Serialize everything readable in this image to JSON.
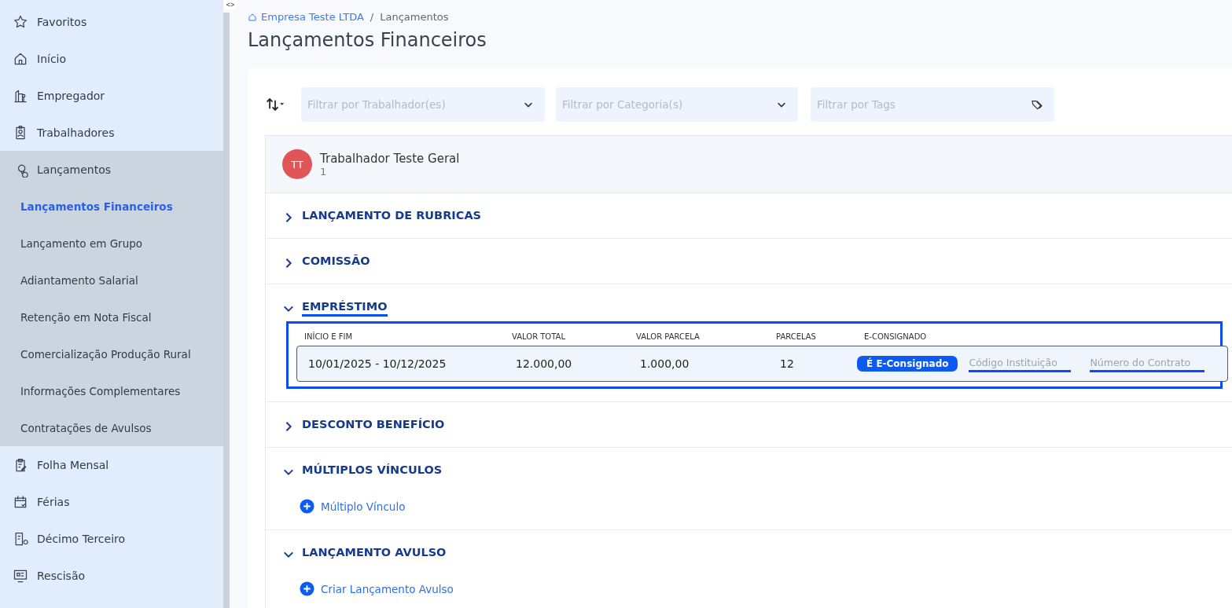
{
  "sidebar": {
    "items": [
      {
        "label": "Favoritos",
        "expanded": false
      },
      {
        "label": "Início",
        "expanded": false
      },
      {
        "label": "Empregador",
        "expanded": false
      },
      {
        "label": "Trabalhadores",
        "expanded": false
      },
      {
        "label": "Lançamentos",
        "expanded": true,
        "children": [
          {
            "label": "Lançamentos Financeiros",
            "selected": true
          },
          {
            "label": "Lançamento em Grupo",
            "selected": false
          },
          {
            "label": "Adiantamento Salarial",
            "selected": false
          },
          {
            "label": "Retenção em Nota Fiscal",
            "selected": false
          },
          {
            "label": "Comercialização Produção Rural",
            "selected": false
          },
          {
            "label": "Informações Complementares",
            "selected": false
          },
          {
            "label": "Contratações de Avulsos",
            "selected": false
          }
        ]
      },
      {
        "label": "Folha Mensal",
        "expanded": false
      },
      {
        "label": "Férias",
        "expanded": false
      },
      {
        "label": "Décimo Terceiro",
        "expanded": false
      },
      {
        "label": "Rescisão",
        "expanded": false
      }
    ]
  },
  "sidebar_toggle": "<>",
  "breadcrumb_separator": "/",
  "breadcrumb": [
    {
      "label": "Empresa Teste LTDA",
      "kind": "home"
    },
    {
      "label": "Lançamentos",
      "kind": "current"
    }
  ],
  "page_title": "Lançamentos Financeiros",
  "filters": [
    {
      "placeholder": "Filtrar por Trabalhador(es)",
      "kind": "dropdown"
    },
    {
      "placeholder": "Filtrar por Categoria(s)",
      "kind": "dropdown"
    },
    {
      "placeholder": "Filtrar por Tags",
      "kind": "tags"
    }
  ],
  "worker": {
    "initials": "TT",
    "name": "Trabalhador Teste Geral",
    "number": "1"
  },
  "sections": [
    {
      "title": "LANÇAMENTO DE RUBRICAS",
      "expanded": false,
      "underlined": false
    },
    {
      "title": "COMISSÃO",
      "expanded": false,
      "underlined": false
    },
    {
      "title": "EMPRÉSTIMO",
      "expanded": true,
      "underlined": true,
      "kind": "table",
      "highlighted": true,
      "columns": [
        "INÍCIO E FIM",
        "VALOR TOTAL",
        "VALOR PARCELA",
        "PARCELAS",
        "E-CONSIGNADO"
      ],
      "rows": [
        {
          "cells": [
            "10/01/2025 - 10/12/2025",
            "12.000,00",
            "1.000,00",
            "12"
          ],
          "badge": "É E-Consignado",
          "fields": [
            {
              "placeholder": "Código Instituição",
              "underlined": true
            },
            {
              "placeholder": "Número do Contrato",
              "underlined": true
            }
          ]
        }
      ]
    },
    {
      "title": "DESCONTO BENEFÍCIO",
      "expanded": false,
      "underlined": false
    },
    {
      "title": "MÚLTIPLOS VÍNCULOS",
      "expanded": true,
      "underlined": false,
      "kind": "action",
      "action": "Múltiplo Vínculo"
    },
    {
      "title": "LANÇAMENTO AVULSO",
      "expanded": true,
      "underlined": false,
      "kind": "action",
      "action": "Criar Lançamento Avulso"
    }
  ]
}
